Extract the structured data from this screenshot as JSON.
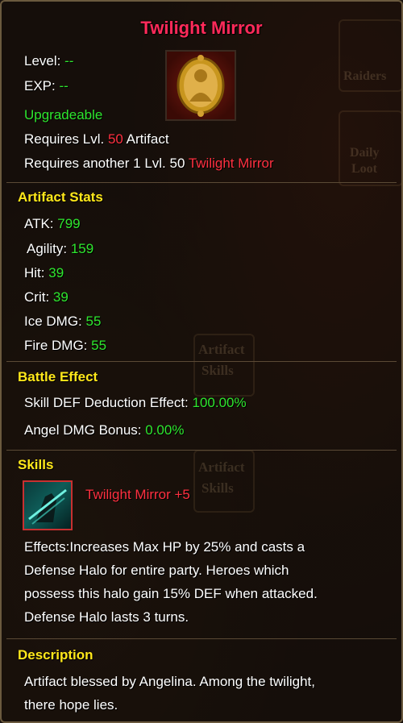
{
  "item": {
    "name": "Twilight Mirror",
    "level_label": "Level:",
    "level_value": "--",
    "exp_label": "EXP:",
    "exp_value": "--",
    "upgradeable": "Upgradeable",
    "req1_prefix": "Requires Lvl.",
    "req1_level": "50",
    "req1_suffix": "Artifact",
    "req2_prefix": "Requires another 1 Lvl. 50",
    "req2_item": "Twilight Mirror"
  },
  "stats": {
    "header": "Artifact Stats",
    "items": [
      {
        "label": "ATK:",
        "value": "799"
      },
      {
        "label": "Agility:",
        "value": "159"
      },
      {
        "label": "Hit:",
        "value": "39"
      },
      {
        "label": "Crit:",
        "value": "39"
      },
      {
        "label": "Ice DMG:",
        "value": "55"
      },
      {
        "label": "Fire DMG:",
        "value": "55"
      }
    ]
  },
  "battle": {
    "header": "Battle Effect",
    "items": [
      {
        "label": "Skill DEF Deduction Effect:",
        "value": "100.00%"
      },
      {
        "label": "Angel DMG Bonus:",
        "value": "0.00%"
      }
    ]
  },
  "skills": {
    "header": "Skills",
    "name": "Twilight Mirror +5",
    "effect_lines": [
      "Effects:Increases Max HP by 25% and casts a",
      "Defense Halo for entire party. Heroes which",
      "possess this halo gain 15% DEF when attacked.",
      "Defense Halo lasts 3 turns."
    ]
  },
  "description": {
    "header": "Description",
    "lines": [
      "Artifact blessed by Angelina. Among the twilight,",
      "there hope lies."
    ]
  },
  "background": {
    "raiders": "Raiders",
    "daily_loot_1": "Daily",
    "daily_loot_2": "Loot",
    "artifact": "Artifact",
    "skills": "Skills"
  },
  "colors": {
    "title": "#ff2a5a",
    "value_green": "#2ee62e",
    "header_yellow": "#ffe81a",
    "requirement_red": "#ff3040"
  }
}
